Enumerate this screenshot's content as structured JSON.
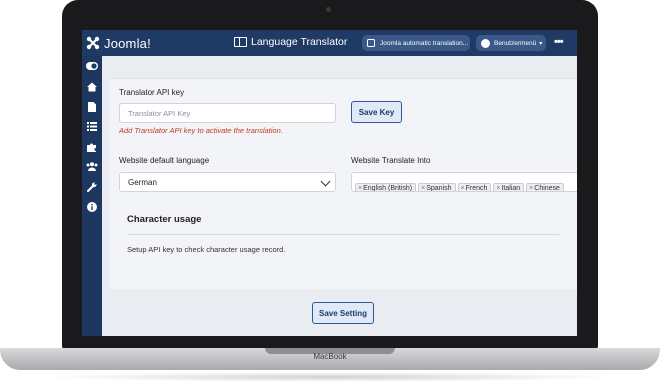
{
  "device": {
    "label": "MacBook"
  },
  "header": {
    "brand": "Joomla!",
    "page_title": "Language Translator",
    "auto_translation_button": "Joomla automatic translation...",
    "user_menu_button": "Benutzermenü",
    "more_icon": "more-dots-icon"
  },
  "sidebar": {
    "items": [
      {
        "icon": "toggle-icon"
      },
      {
        "icon": "home-icon"
      },
      {
        "icon": "file-icon"
      },
      {
        "icon": "list-icon"
      },
      {
        "icon": "puzzle-icon"
      },
      {
        "icon": "users-icon"
      },
      {
        "icon": "wrench-icon"
      },
      {
        "icon": "info-icon"
      }
    ]
  },
  "form": {
    "api_key_label": "Translator API key",
    "api_key_placeholder": "Translator API Key",
    "api_key_hint": "Add Translator API key to activate the translation.",
    "save_key_button": "Save Key",
    "default_language_label": "Website default language",
    "default_language_value": "German",
    "translate_into_label": "Website Translate Into",
    "translate_into_tags": [
      "English (British)",
      "Spanish",
      "French",
      "Italian",
      "Chinese"
    ],
    "tag_remove_glyph": "×"
  },
  "usage": {
    "heading": "Character usage",
    "note": "Setup API key to check character usage record."
  },
  "footer": {
    "save_setting_button": "Save Setting"
  },
  "colors": {
    "header": "#1f3a64",
    "sidebar": "#1d3760",
    "accent": "#2f5a8f",
    "error": "#c0392b"
  }
}
